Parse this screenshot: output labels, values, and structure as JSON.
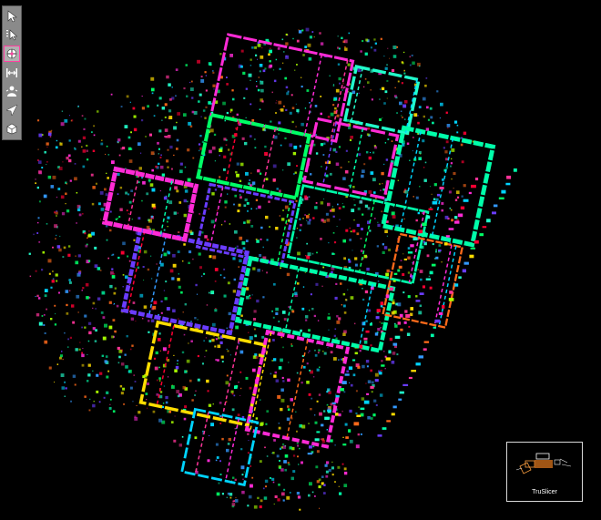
{
  "toolbar": {
    "tools": [
      {
        "icon": "select-arrow-icon",
        "active": false
      },
      {
        "icon": "multi-select-icon",
        "active": false
      },
      {
        "icon": "orbit-navigate-icon",
        "active": true
      },
      {
        "icon": "measure-distance-icon",
        "active": false
      },
      {
        "icon": "walk-person-icon",
        "active": false
      },
      {
        "icon": "fly-navigate-icon",
        "active": false
      },
      {
        "icon": "slice-box-icon",
        "active": false
      }
    ],
    "active_color": "#ff40a0"
  },
  "minimap": {
    "label": "TruSlicer"
  },
  "pointcloud": {
    "palette": [
      "#00ff66",
      "#22ffcc",
      "#00d4ff",
      "#3399ff",
      "#6a3cff",
      "#ff2bd6",
      "#ff3399",
      "#ffdd00",
      "#ff6a1a",
      "#aaff00",
      "#ff0033",
      "#00ffaa"
    ]
  }
}
